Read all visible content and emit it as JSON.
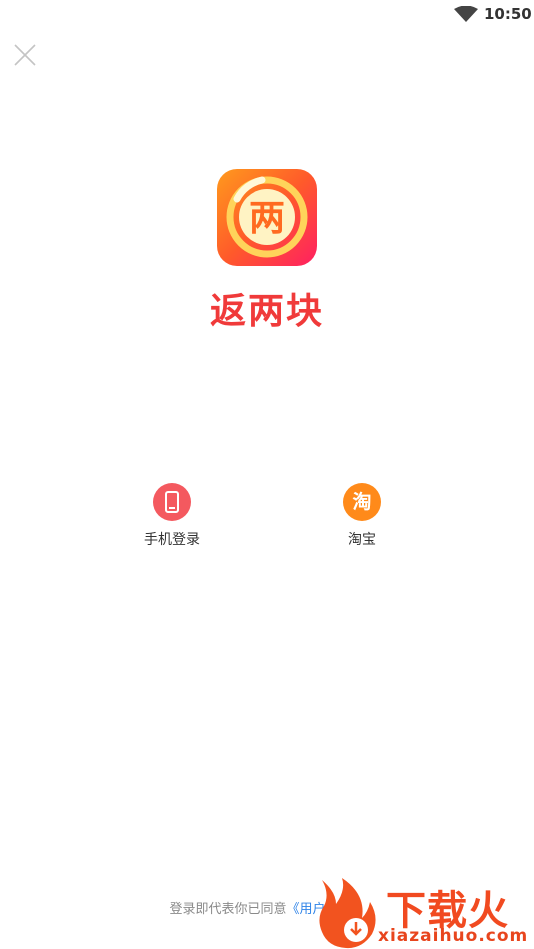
{
  "status_bar": {
    "time": "10:50",
    "wifi_icon": "wifi-icon"
  },
  "app": {
    "name": "返两块",
    "logo_glyph": "两",
    "brand_color": "#f03a3a"
  },
  "login_options": [
    {
      "label": "手机登录",
      "icon": "phone-icon",
      "color": "#f4595f"
    },
    {
      "label": "淘宝",
      "icon": "taobao-icon",
      "glyph": "淘",
      "color": "#ff8a1a"
    }
  ],
  "agreement": {
    "prefix": "登录即代表你已同意",
    "link": "《用户协议》",
    "link_color": "#2e83e8"
  },
  "watermark": {
    "title": "下载火",
    "url": "xiazaihuo.com"
  }
}
